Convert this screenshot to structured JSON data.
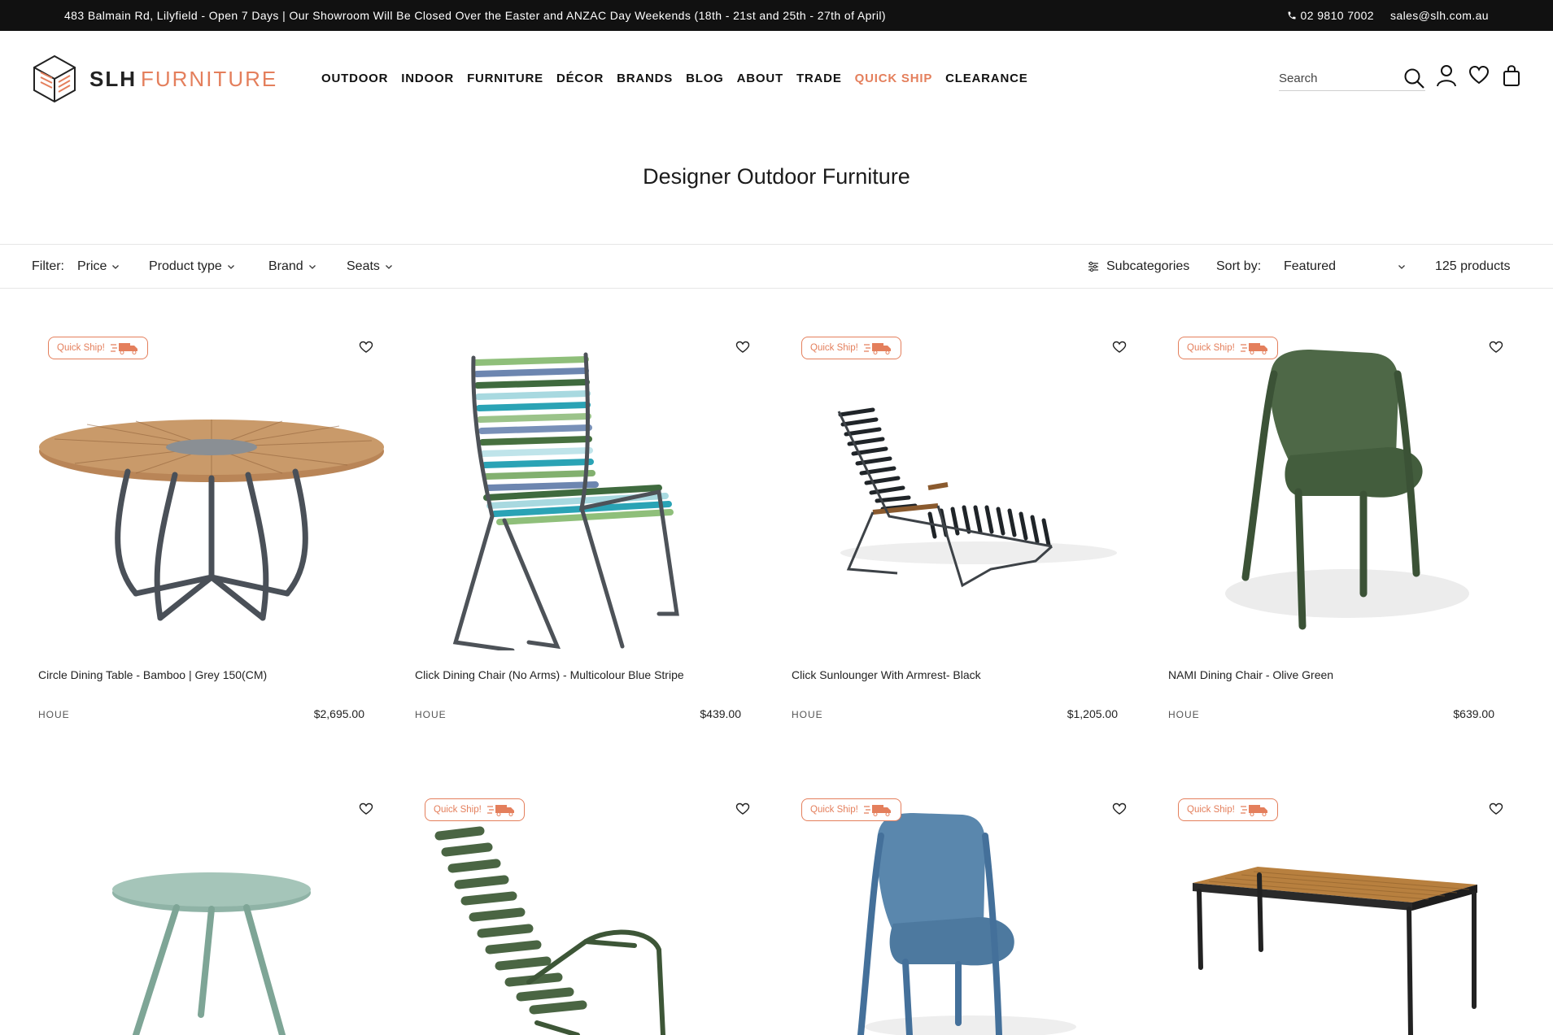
{
  "announcement": {
    "message": "483 Balmain Rd, Lilyfield - Open 7 Days | Our Showroom Will Be Closed Over the Easter and ANZAC Day Weekends (18th - 21st and 25th - 27th of April)",
    "phone": "02 9810 7002",
    "email": "sales@slh.com.au"
  },
  "brand": {
    "name_bold": "SLH",
    "name_light": "FURNITURE",
    "accent_color": "#e47f5c"
  },
  "nav": [
    "OUTDOOR",
    "INDOOR",
    "FURNITURE",
    "DÉCOR",
    "BRANDS",
    "BLOG",
    "ABOUT",
    "TRADE",
    "QUICK SHIP",
    "CLEARANCE"
  ],
  "search": {
    "placeholder": "Search"
  },
  "page": {
    "title": "Designer Outdoor Furniture"
  },
  "filters": {
    "label": "Filter:",
    "options": [
      "Price",
      "Product type",
      "Brand",
      "Seats"
    ],
    "subcategories": "Subcategories",
    "sort_label": "Sort by:",
    "sort_value": "Featured",
    "count": "125 products"
  },
  "badge_label": "Quick Ship!",
  "products": [
    {
      "name": "Circle Dining Table - Bamboo | Grey 150(CM)",
      "brand": "HOUE",
      "price": "$2,695.00",
      "quick_ship": true
    },
    {
      "name": "Click Dining Chair (No Arms) - Multicolour Blue Stripe",
      "brand": "HOUE",
      "price": "$439.00",
      "quick_ship": false
    },
    {
      "name": "Click Sunlounger With Armrest- Black",
      "brand": "HOUE",
      "price": "$1,205.00",
      "quick_ship": true
    },
    {
      "name": "NAMI Dining Chair - Olive Green",
      "brand": "HOUE",
      "price": "$639.00",
      "quick_ship": true
    },
    {
      "name": "",
      "brand": "",
      "price": "",
      "quick_ship": false
    },
    {
      "name": "",
      "brand": "",
      "price": "",
      "quick_ship": true
    },
    {
      "name": "",
      "brand": "",
      "price": "",
      "quick_ship": true
    },
    {
      "name": "",
      "brand": "",
      "price": "",
      "quick_ship": true
    }
  ]
}
